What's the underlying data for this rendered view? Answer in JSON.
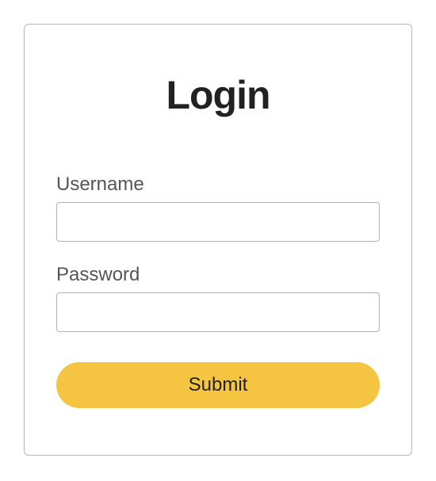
{
  "form": {
    "title": "Login",
    "username": {
      "label": "Username",
      "value": "",
      "placeholder": ""
    },
    "password": {
      "label": "Password",
      "value": "",
      "placeholder": ""
    },
    "submit_label": "Submit"
  },
  "colors": {
    "accent": "#f5c542"
  }
}
